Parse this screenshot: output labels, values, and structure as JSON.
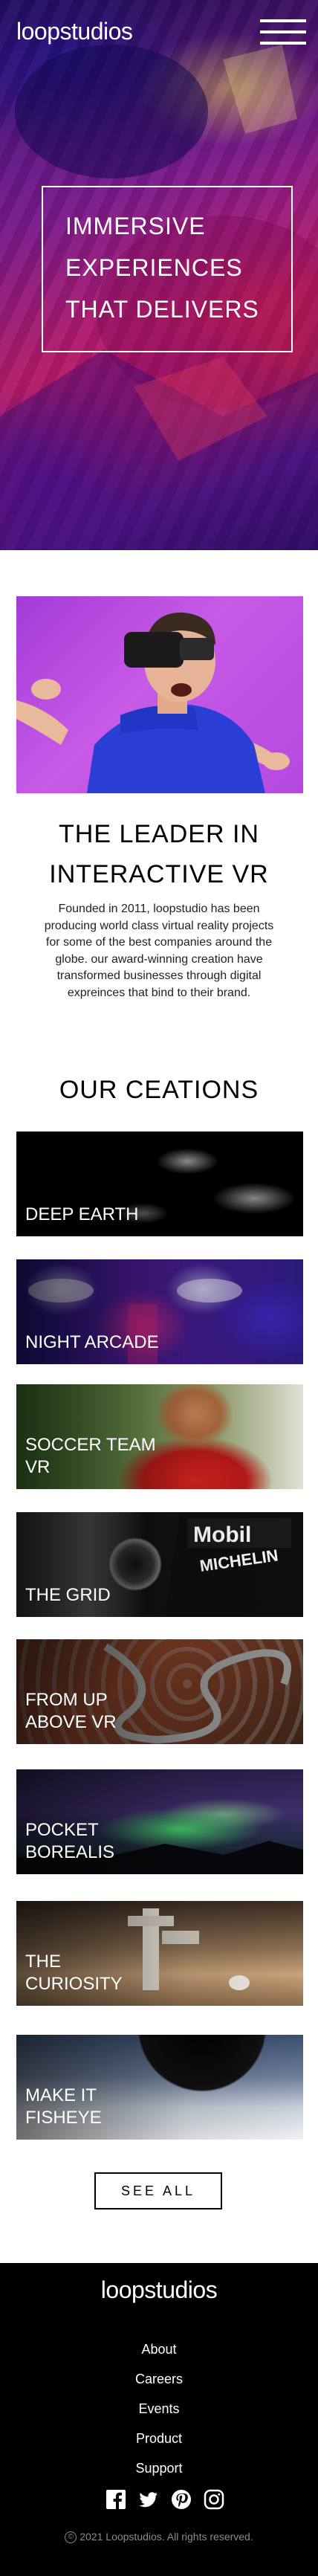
{
  "header": {
    "logo": "loopstudios",
    "menu_icon": "hamburger-menu-icon"
  },
  "hero": {
    "title": "IMMERSIVE EXPERIENCES THAT DELIVERS"
  },
  "intro": {
    "title": "THE LEADER IN INTERACTIVE VR",
    "text": "Founded in 2011, loopstudio has been producing world class virtual reality projects for some of the best companies around the globe. our award-winning creation have transformed businesses through digital expreinces that bind to their brand."
  },
  "creations": {
    "title": "OUR CEATIONS",
    "items": [
      {
        "label": "DEEP EARTH"
      },
      {
        "label": "NIGHT ARCADE"
      },
      {
        "label": "SOCCER TEAM VR"
      },
      {
        "label": "THE GRID"
      },
      {
        "label": "FROM UP ABOVE VR"
      },
      {
        "label": "POCKET BOREALIS"
      },
      {
        "label": "THE CURIOSITY"
      },
      {
        "label": "MAKE IT FISHEYE"
      }
    ],
    "see_all": "SEE ALL"
  },
  "footer": {
    "logo": "loopstudios",
    "nav": [
      "About",
      "Careers",
      "Events",
      "Product",
      "Support"
    ],
    "socials": [
      "facebook-icon",
      "twitter-icon",
      "pinterest-icon",
      "instagram-icon"
    ],
    "copyright": "2021 Loopstudios. All rights reserved."
  }
}
